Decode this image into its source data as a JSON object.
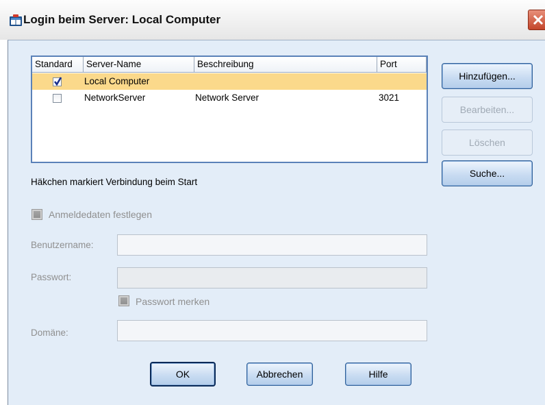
{
  "window": {
    "title": "Login beim Server: Local Computer",
    "icon": "spss-server-icon",
    "close_icon": "close-icon"
  },
  "server_list": {
    "columns": [
      "Standard",
      "Server-Name",
      "Beschreibung",
      "Port"
    ],
    "rows": [
      {
        "standard": true,
        "name": "Local Computer",
        "description": "",
        "port": "",
        "selected": true
      },
      {
        "standard": false,
        "name": "NetworkServer",
        "description": "Network Server",
        "port": "3021",
        "selected": false
      }
    ]
  },
  "buttons": {
    "add": "Hinzufügen...",
    "edit": "Bearbeiten...",
    "delete": "Löschen",
    "search": "Suche...",
    "ok": "OK",
    "cancel": "Abbrechen",
    "help": "Hilfe"
  },
  "hint": "Häkchen markiert Verbindung beim Start",
  "credentials": {
    "set_label": "Anmeldedaten festlegen",
    "username_label": "Benutzername:",
    "username_value": "",
    "password_label": "Passwort:",
    "password_value": "",
    "remember_label": "Passwort merken",
    "domain_label": "Domäne:",
    "domain_value": ""
  },
  "colors": {
    "selection": "#fbd98b",
    "dialog_bg": "#e3edf8",
    "close_button": "#c3462b"
  }
}
